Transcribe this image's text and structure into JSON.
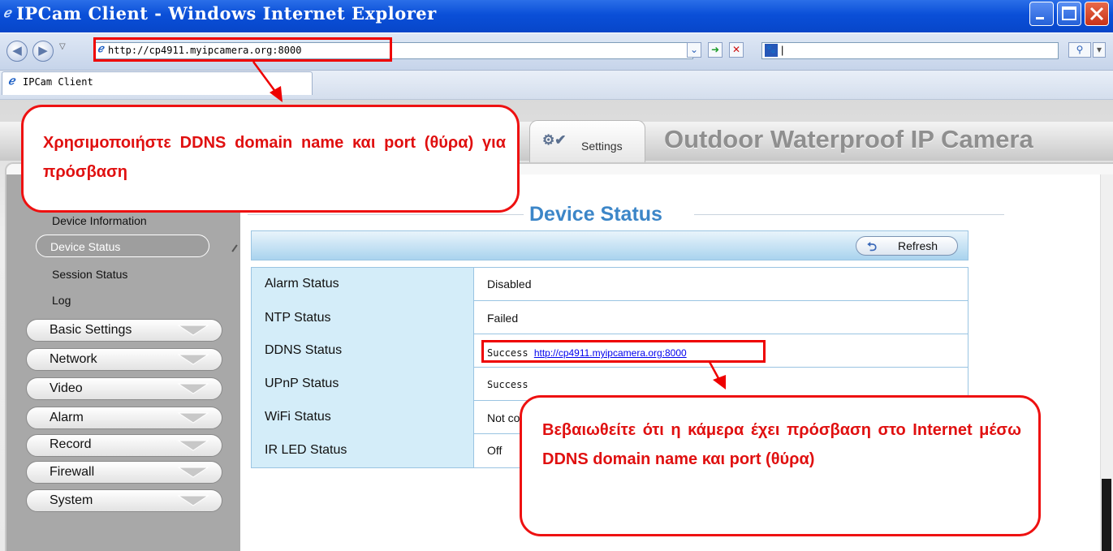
{
  "window": {
    "title": "IPCam Client - Windows Internet Explorer"
  },
  "browser": {
    "address": "http://cp4911.myipcamera.org:8000",
    "search_value": "|",
    "tab_title": "IPCam Client"
  },
  "header": {
    "settings_tab": "Settings",
    "camera_title": "Outdoor Waterproof IP Camera"
  },
  "sidebar": {
    "sub_items": [
      "Device Information",
      "Device Status",
      "Session Status",
      "Log"
    ],
    "menu": [
      "Basic Settings",
      "Network",
      "Video",
      "Alarm",
      "Record",
      "Firewall",
      "System"
    ]
  },
  "main": {
    "title": "Device Status",
    "refresh_label": "Refresh",
    "rows": [
      {
        "label": "Alarm Status",
        "value": "Disabled"
      },
      {
        "label": "NTP Status",
        "value": "Failed"
      },
      {
        "label": "DDNS Status",
        "value": "Success",
        "link": "http://cp4911.myipcamera.org:8000"
      },
      {
        "label": "UPnP Status",
        "value": "Success"
      },
      {
        "label": "WiFi Status",
        "value": "Not co"
      },
      {
        "label": "IR LED Status",
        "value": "Off"
      }
    ]
  },
  "annotations": {
    "callout1": "Χρησιμοποιήστε DDNS domain name και port (θύρα) για πρόσβαση",
    "callout2": "Βεβαιωθείτε ότι η κάμερα έχει πρόσβαση στο Internet μέσω DDNS domain name και port (θύρα)",
    "color": "#ee0000"
  }
}
